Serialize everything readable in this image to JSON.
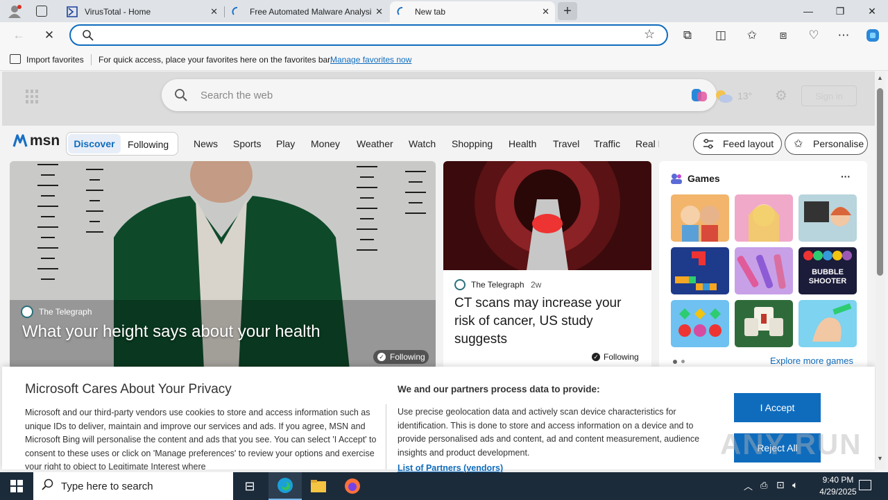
{
  "tabs": [
    {
      "title": "VirusTotal - Home"
    },
    {
      "title": "Free Automated Malware Analysi"
    },
    {
      "title": "New tab"
    }
  ],
  "favorites_bar": {
    "import_label": "Import favorites",
    "hint": "For quick access, place your favorites here on the favorites bar.",
    "manage_link": "Manage favorites now"
  },
  "msn": {
    "search_placeholder": "Search the web",
    "temperature": "13°",
    "sign_in": "Sign in",
    "logo_text": "msn",
    "toggle": [
      "Discover",
      "Following"
    ],
    "nav": [
      "News",
      "Sports",
      "Play",
      "Money",
      "Weather",
      "Watch",
      "Shopping",
      "Health",
      "Travel",
      "Traffic",
      "Real E"
    ],
    "feed_layout": "Feed layout",
    "personalise": "Personalise"
  },
  "hero": {
    "source": "The Telegraph",
    "headline": "What your height says about your health",
    "following": "Following"
  },
  "card2": {
    "source": "The Telegraph",
    "age": "2w",
    "headline": "CT scans may increase your risk of cancer, US study suggests",
    "following": "Following"
  },
  "games": {
    "title": "Games",
    "more": "···",
    "explore": "Explore more games",
    "bubble_label": "BUBBLE SHOOTER"
  },
  "consent": {
    "title": "Microsoft Cares About Your Privacy",
    "body": "Microsoft and our third-party vendors use cookies to store and access information such as unique IDs to deliver, maintain and improve our services and ads. If you agree, MSN and Microsoft Bing will personalise the content and ads that you see. You can select 'I Accept' to consent to these uses or click on 'Manage preferences' to review your options and exercise your right to object to Legitimate Interest where",
    "process_title": "We and our partners process data to provide:",
    "process_body": "Use precise geolocation data and actively scan device characteristics for identification. This is done to store and access information on a device and to provide personalised ads and content, ad and content measurement, audience insights and product development.",
    "partners_link": "List of Partners (vendors)",
    "accept": "I Accept",
    "reject": "Reject All"
  },
  "watermark": "ANY RUN",
  "taskbar": {
    "search_placeholder": "Type here to search",
    "time": "9:40 PM",
    "date": "4/29/2025"
  },
  "colors": {
    "accent": "#0f6cbd",
    "taskbar": "#1c2b3a"
  }
}
